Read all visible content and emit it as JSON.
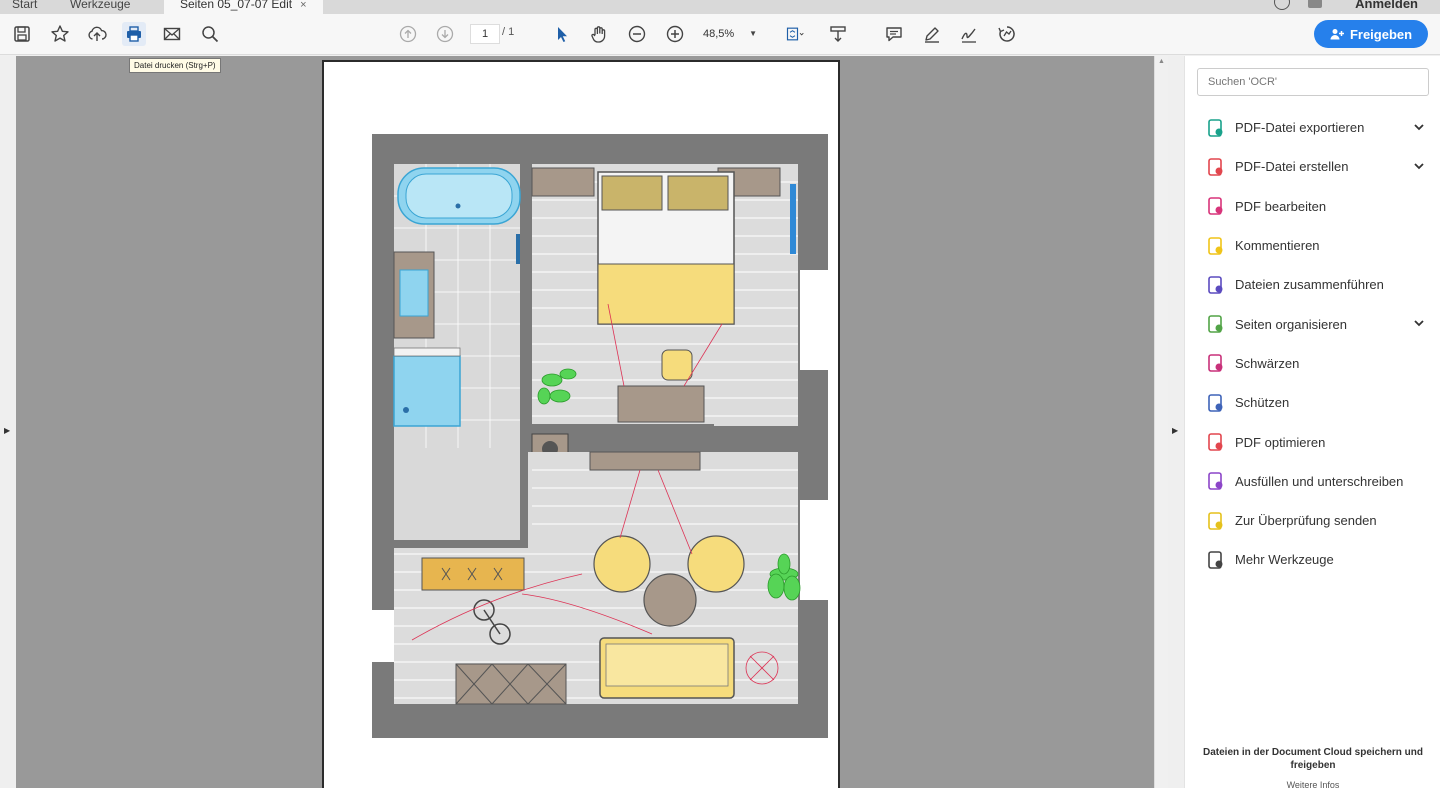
{
  "tabs": [
    {
      "label": "Start"
    },
    {
      "label": "Werkzeuge"
    },
    {
      "label": "Seiten 05_07-07 Edit",
      "active": true
    }
  ],
  "account": {
    "signin_label": "Anmelden"
  },
  "toolbar": {
    "tooltip": "Datei drucken (Strg+P)",
    "page_current": "1",
    "page_total": "/ 1",
    "zoom": "48,5%",
    "share_label": "Freigeben"
  },
  "search": {
    "placeholder": "Suchen 'OCR'"
  },
  "tools": [
    {
      "label": "PDF-Datei exportieren",
      "icon": "export-pdf-icon",
      "color": "#19a28b",
      "expandable": true
    },
    {
      "label": "PDF-Datei erstellen",
      "icon": "create-pdf-icon",
      "color": "#e2464e",
      "expandable": true
    },
    {
      "label": "PDF bearbeiten",
      "icon": "edit-pdf-icon",
      "color": "#d8347a",
      "expandable": false
    },
    {
      "label": "Kommentieren",
      "icon": "comment-icon",
      "color": "#f0c419",
      "expandable": false
    },
    {
      "label": "Dateien zusammenführen",
      "icon": "combine-files-icon",
      "color": "#5b4bbf",
      "expandable": false
    },
    {
      "label": "Seiten organisieren",
      "icon": "organize-pages-icon",
      "color": "#52a447",
      "expandable": true
    },
    {
      "label": "Schwärzen",
      "icon": "redact-icon",
      "color": "#c8317a",
      "expandable": false
    },
    {
      "label": "Schützen",
      "icon": "protect-icon",
      "color": "#3e63b8",
      "expandable": false
    },
    {
      "label": "PDF optimieren",
      "icon": "optimize-pdf-icon",
      "color": "#e2464e",
      "expandable": false
    },
    {
      "label": "Ausfüllen und unterschreiben",
      "icon": "fill-sign-icon",
      "color": "#8c45c8",
      "expandable": false
    },
    {
      "label": "Zur Überprüfung senden",
      "icon": "send-review-icon",
      "color": "#e5c11c",
      "expandable": false
    },
    {
      "label": "Mehr Werkzeuge",
      "icon": "more-tools-icon",
      "color": "#444444",
      "expandable": false
    }
  ],
  "cloud": {
    "text": "Dateien in der Document Cloud speichern und freigeben",
    "more": "Weitere Infos"
  },
  "colors": {
    "accent": "#2680eb",
    "canvas": "#999999",
    "wall": "#7a7a7a",
    "furniture_yellow": "#f6dc7c",
    "fixture_blue": "#68c8ea"
  }
}
